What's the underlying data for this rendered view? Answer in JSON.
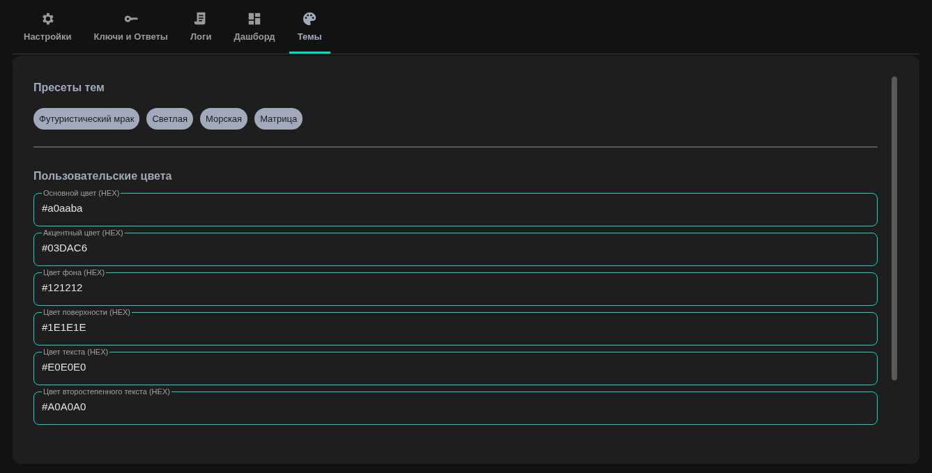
{
  "tabs": [
    {
      "label": "Настройки",
      "kind": "gear",
      "selected": false
    },
    {
      "label": "Ключи и Ответы",
      "kind": "key",
      "selected": false
    },
    {
      "label": "Логи",
      "kind": "receipt",
      "selected": false
    },
    {
      "label": "Дашборд",
      "kind": "dashboard",
      "selected": false
    },
    {
      "label": "Темы",
      "kind": "palette",
      "selected": true
    }
  ],
  "presets": {
    "title": "Пресеты тем",
    "items": [
      "Футуристический мрак",
      "Светлая",
      "Морская",
      "Матрица"
    ]
  },
  "custom_colors": {
    "title": "Пользовательские цвета",
    "fields": [
      {
        "label": "Основной цвет (HEX)",
        "value": "#a0aaba"
      },
      {
        "label": "Акцентный цвет (HEX)",
        "value": "#03DAC6"
      },
      {
        "label": "Цвет фона (HEX)",
        "value": "#121212"
      },
      {
        "label": "Цвет поверхности (HEX)",
        "value": "#1E1E1E"
      },
      {
        "label": "Цвет текста (HEX)",
        "value": "#E0E0E0"
      },
      {
        "label": "Цвет второстепенного текста (HEX)",
        "value": "#A0A0A0"
      }
    ]
  }
}
